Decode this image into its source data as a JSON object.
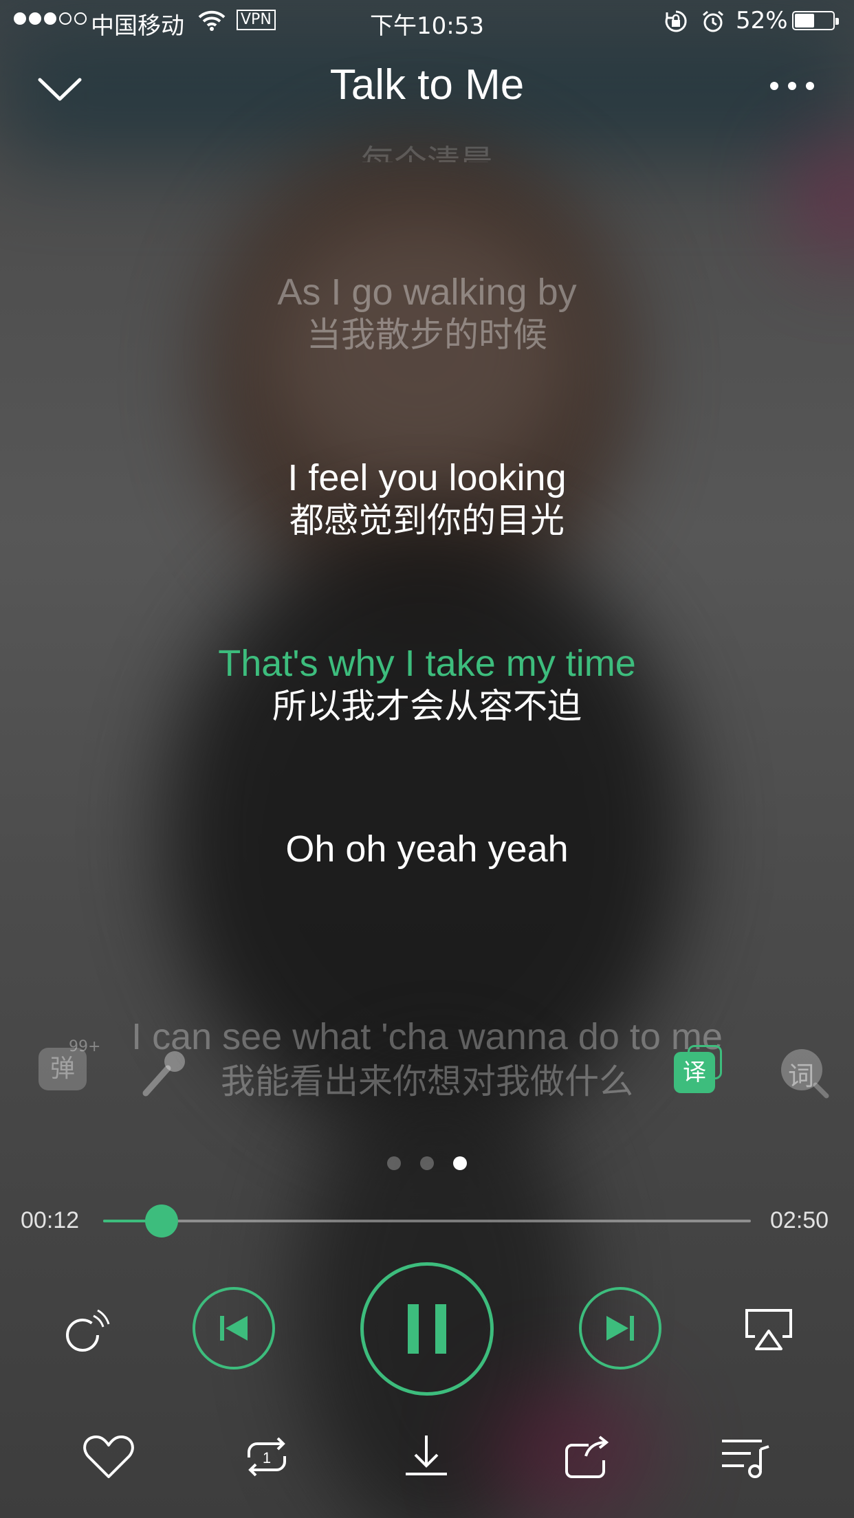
{
  "status_bar": {
    "carrier": "中国移动",
    "vpn": "VPN",
    "time": "下午10:53",
    "battery_percent": "52%",
    "battery_level": 0.52
  },
  "nav": {
    "title": "Talk to Me",
    "back_icon": "chevron-down-icon",
    "more_icon": "more-icon"
  },
  "lyrics": {
    "ghost_top": "每个清晨",
    "lines": [
      {
        "en": "As I go walking by",
        "zh": "当我散步的时候"
      },
      {
        "en": "I feel you looking",
        "zh": "都感觉到你的目光"
      },
      {
        "en": "That's why I take my time",
        "zh": "所以我才会从容不迫"
      },
      {
        "en": "Oh oh yeah yeah",
        "zh": ""
      },
      {
        "en": "I can see what 'cha wanna do to me",
        "zh": "我能看出来你想对我做什么"
      }
    ]
  },
  "tools": {
    "danmu_label": "弹",
    "danmu_badge": "99+",
    "translate_label": "译",
    "lyric_search_label": "词"
  },
  "pager": {
    "count": 3,
    "active_index": 2
  },
  "progress": {
    "elapsed": "00:12",
    "duration": "02:50",
    "fraction": 0.09
  },
  "colors": {
    "accent": "#3dbd7d"
  }
}
